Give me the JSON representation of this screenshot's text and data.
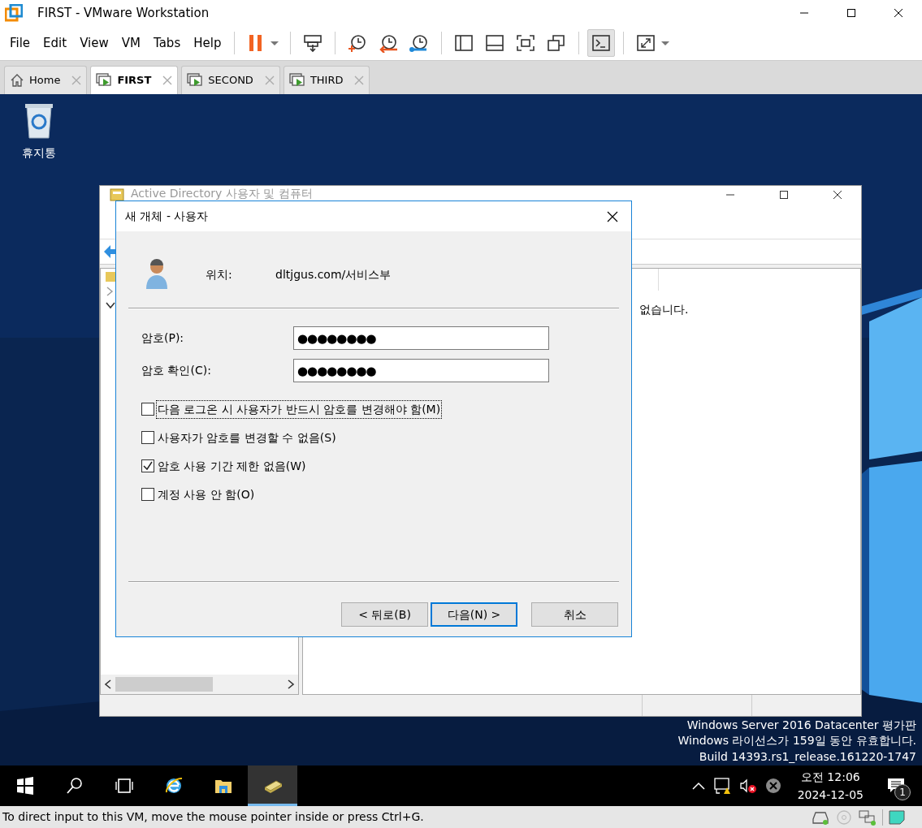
{
  "window": {
    "title": "FIRST - VMware Workstation"
  },
  "menu": [
    "File",
    "Edit",
    "View",
    "VM",
    "Tabs",
    "Help"
  ],
  "console_view": {
    "on": true
  },
  "tabs": [
    {
      "label": "Home",
      "kind": "home",
      "selected": false
    },
    {
      "label": "FIRST",
      "kind": "vm",
      "selected": true
    },
    {
      "label": "SECOND",
      "kind": "vm",
      "selected": false
    },
    {
      "label": "THIRD",
      "kind": "vm",
      "selected": false
    }
  ],
  "desktop_icons": [
    {
      "label": "휴지통"
    }
  ],
  "aduc": {
    "title": "Active Directory 사용자 및 컴퓨터",
    "message": "없습니다."
  },
  "dialog": {
    "title": "새 개체 - 사용자",
    "location_label": "위치:",
    "location": "dltjgus.com/서비스부",
    "fields": [
      {
        "label": "암호(P):",
        "value": "●●●●●●●●"
      },
      {
        "label": "암호 확인(C):",
        "value": "●●●●●●●●"
      }
    ],
    "options": [
      {
        "label": "다음 로그온 시 사용자가 반드시 암호를 변경해야 함(M)",
        "checked": false,
        "focused": true
      },
      {
        "label": "사용자가 암호를 변경할 수 없음(S)",
        "checked": false,
        "focused": false
      },
      {
        "label": "암호 사용 기간 제한 없음(W)",
        "checked": true,
        "focused": false
      },
      {
        "label": "계정 사용 안 함(O)",
        "checked": false,
        "focused": false
      }
    ],
    "buttons": [
      {
        "label": "< 뒤로(B)",
        "default": false
      },
      {
        "label": "다음(N) >",
        "default": true
      },
      {
        "label": "취소",
        "default": false
      }
    ]
  },
  "os_notice": [
    "Windows Server 2016 Datacenter 평가판",
    "Windows 라이선스가 159일 동안 유효합니다.",
    "Build 14393.rs1_release.161220-1747"
  ],
  "taskbar": {
    "apps": [
      {
        "kind": "start",
        "selected": false
      },
      {
        "kind": "search",
        "selected": false
      },
      {
        "kind": "task-view",
        "selected": false
      },
      {
        "kind": "browser",
        "selected": false
      },
      {
        "kind": "folder",
        "selected": false
      },
      {
        "kind": "directory",
        "selected": true
      }
    ],
    "time": "오전 12:06",
    "date": "2024-12-05",
    "notifications": "1"
  },
  "status_bar": {
    "text": "To direct input to this VM, move the mouse pointer inside or press Ctrl+G."
  }
}
